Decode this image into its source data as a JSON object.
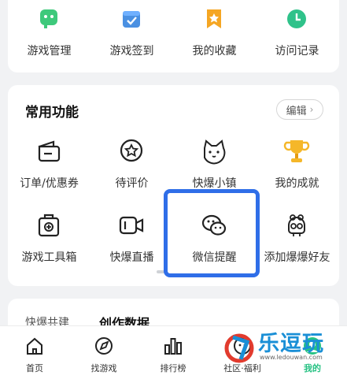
{
  "top_row": [
    {
      "label": "游戏管理",
      "icon": "game-controller-icon",
      "color": "#3ec97b"
    },
    {
      "label": "游戏签到",
      "icon": "calendar-check-icon",
      "color": "#4a90e2"
    },
    {
      "label": "我的收藏",
      "icon": "bookmark-star-icon",
      "color": "#f5a623"
    },
    {
      "label": "访问记录",
      "icon": "clock-icon",
      "color": "#2fc28a"
    }
  ],
  "common": {
    "title": "常用功能",
    "edit_label": "编辑",
    "items": [
      {
        "label": "订单/优惠券",
        "icon": "wallet-icon"
      },
      {
        "label": "待评价",
        "icon": "star-chat-icon"
      },
      {
        "label": "快爆小镇",
        "icon": "cat-face-icon"
      },
      {
        "label": "我的成就",
        "icon": "trophy-icon"
      },
      {
        "label": "游戏工具箱",
        "icon": "toolbox-icon"
      },
      {
        "label": "快爆直播",
        "icon": "video-camera-icon"
      },
      {
        "label": "微信提醒",
        "icon": "wechat-icon"
      },
      {
        "label": "添加爆爆好友",
        "icon": "friend-mascot-icon"
      }
    ]
  },
  "creator": {
    "tabs": [
      "快爆共建",
      "创作数据"
    ]
  },
  "bottom_nav": [
    {
      "label": "首页",
      "icon": "home-icon"
    },
    {
      "label": "找游戏",
      "icon": "compass-icon"
    },
    {
      "label": "排行榜",
      "icon": "bar-chart-icon"
    },
    {
      "label": "社区·福利",
      "icon": "community-icon"
    },
    {
      "label": "我的",
      "icon": "profile-icon",
      "active": true
    }
  ],
  "watermark": {
    "text": "乐逗玩",
    "url": "www.ledouwan.com"
  },
  "colors": {
    "accent": "#26c283",
    "highlight": "#2f6ee8"
  }
}
